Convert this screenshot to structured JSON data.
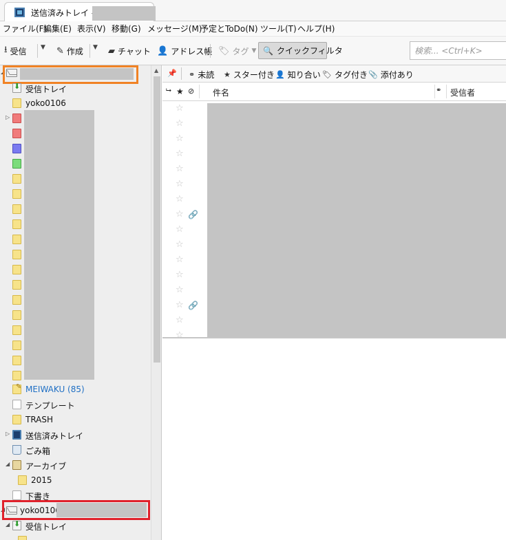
{
  "window": {
    "tab_title": "送信済みトレイ -"
  },
  "menu": [
    "ファイル(F)",
    "編集(E)",
    "表示(V)",
    "移動(G)",
    "メッセージ(M)",
    "予定とToDo(N)",
    "ツール(T)",
    "ヘルプ(H)"
  ],
  "toolbar": {
    "get_mail": "受信",
    "write": "作成",
    "chat": "チャット",
    "address_book": "アドレス帳",
    "tag": "タグ",
    "quick_filter": "クイックフィルタ",
    "search_placeholder": "検索... <Ctrl+K>"
  },
  "quick_filter_bar": {
    "unread": "未読",
    "starred": "スター付き",
    "contacts": "知り合い",
    "tagged": "タグ付き",
    "attachment": "添付あり"
  },
  "columns": {
    "subject": "件名",
    "recipient": "受信者"
  },
  "folders": {
    "inbox": "受信トレイ",
    "yoko": "yoko0106",
    "meiwaku": "MEIWAKU (85)",
    "template": "テンプレート",
    "trash_en": "TRASH",
    "sent": "送信済みトレイ",
    "trash": "ごみ箱",
    "archive": "アーカイブ",
    "archive_2015": "2015",
    "drafts": "下書き",
    "account2": "yoko0106",
    "inbox2": "受信トレイ"
  },
  "colors": {
    "meiwaku_text": "#1f6fc4",
    "highlight_orange": "#f08224",
    "highlight_red": "#e0212b",
    "redaction": "#c4c4c4"
  }
}
